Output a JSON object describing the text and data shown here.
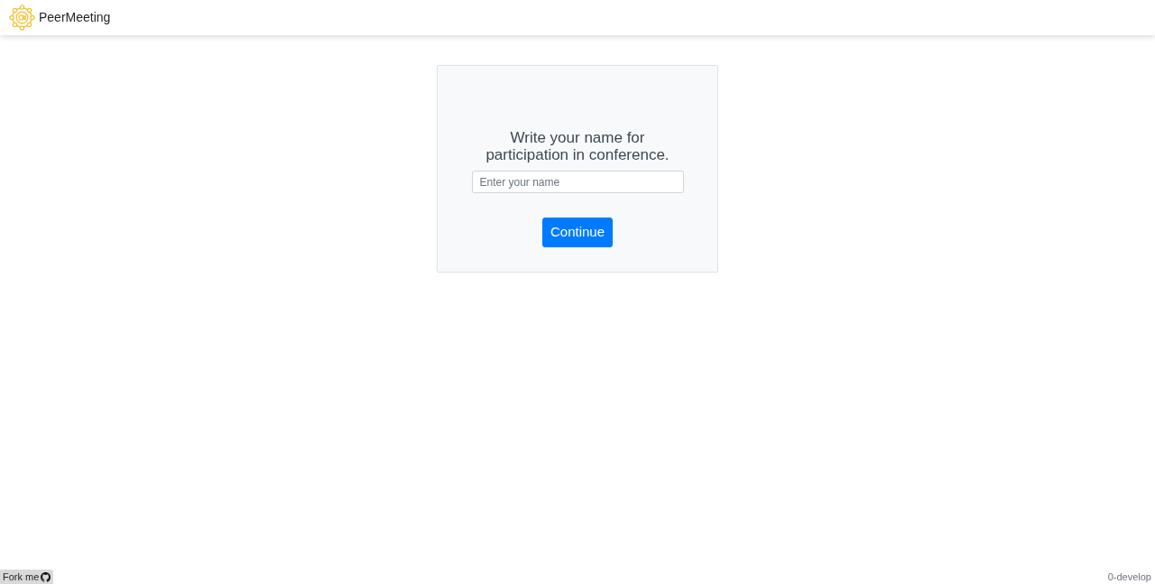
{
  "navbar": {
    "brand": "PeerMeeting"
  },
  "form": {
    "prompt": "Write your name for participation in conference.",
    "name_field": {
      "placeholder": "Enter your name"
    },
    "submit": "Continue"
  },
  "footer": {
    "fork_link": "Fork me",
    "version": "0-develop"
  }
}
